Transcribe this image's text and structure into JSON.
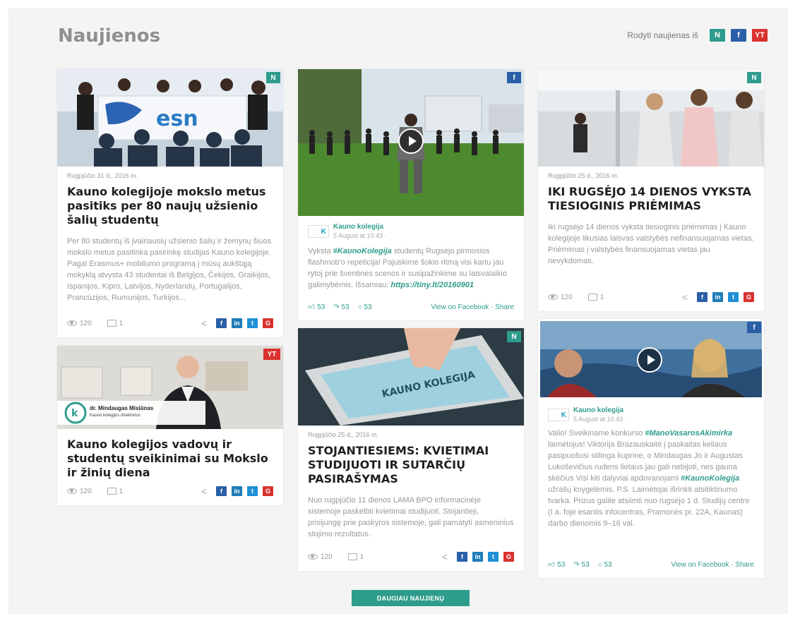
{
  "page_title": "Naujienos",
  "filter": {
    "label": "Rodyti naujienas iš",
    "buttons": [
      "N",
      "f",
      "YT"
    ]
  },
  "colors": {
    "accent": "#2e9c8d",
    "facebook": "#2a5fa7",
    "youtube": "#d9322f"
  },
  "cards": {
    "esn": {
      "source": "N",
      "date": "Rugpjūčio 31 d., 2016 m.",
      "title": "Kauno kolegijoje mokslo metus pasitiks per 80 naujų užsienio šalių studentų",
      "excerpt": "Per 80 studentų iš įvairiausių užsienio šalių ir žemynų šiuos mokslo metus pasitinka pasirinkę studijas Kauno kolegijoje. Pagal Erasmus+ mobilumo programą į mūsų aukštąją mokyklą atvysta 43 studentai iš Belgijos, Čekijos, Graikijos, Ispanijos, Kipro, Latvijos,  Nyderlandų, Portugalijos, Prancūzijos, Rumunijos,  Turkijos...",
      "image_text": "esn",
      "views": "120",
      "comments": "1"
    },
    "director": {
      "source": "YT",
      "title": "Kauno kolegijos vadovų ir studentų sveikinimai su Mokslo ir žinių diena",
      "caption_name": "dr. Mindaugas Misiūnas",
      "caption_role": "Kauno kolegijos direktorius",
      "views": "120",
      "comments": "1"
    },
    "flashmob": {
      "source": "f",
      "author": "Kauno kolegija",
      "time": "5 August at 10:43 ·",
      "text_before": "Vyksta ",
      "tag": "#KaunoKolegija",
      "text_after": " studentų Rugsėjo pirmosios flashmob'o repeticija! Pajuskime šokio ritmą visi kartu jau rytoj prie šventinės scenos ir susipažinkime su laisvalaikio galimybėmis. Išsamiau: ",
      "link": "https://tiny.lt/20160901",
      "likes": "53",
      "shares": "53",
      "comments": "53",
      "view_label": "View on Facebook · Share"
    },
    "tablet": {
      "source": "N",
      "date": "Rugpjūčio 25 d., 2016 m.",
      "title": "STOJANTIESIEMS: KVIETIMAI STUDIJUOTI IR SUTARČIŲ PASIRAŠYMAS",
      "excerpt": "Nuo rugpjūčio 11 dienos  LAMA BPO informacinėje sistemoje paskelbti kvietimai studijuoti. Stojantieji, prisijungę prie paskyros sistemoje, gali pamatyti asmeninius stojimo rezultatus.",
      "screen_text": "KAUNO KOLEGIJA",
      "views": "120",
      "comments": "1"
    },
    "admission": {
      "source": "N",
      "date": "Rugpjūčio 25 d., 2016 m.",
      "title": "IKI RUGSĖJO 14 DIENOS VYKSTA TIESIOGINIS PRIĖMIMAS",
      "excerpt": "Iki rugsėjo 14 dienos vyksta tiesioginis priėmimas į Kauno kolegijoje likusias laisvas valstybės nefinansuojamas vietas. Priėmimas į valstybės finansuojamas vietas jau nevykdomas.",
      "views": "120",
      "comments": "1"
    },
    "contest": {
      "source": "f",
      "author": "Kauno kolegija",
      "time": "5 August at 10:43 ·",
      "text_1": "Valio! Sveikiname konkurso ",
      "tag_1": "#ManoVasarosAkimirka",
      "text_2": " laimėtojus! Viktorija Brazauskaitė į paskaitas keliaus pasipuošusi stilinga kuprine, o Mindaugas Jo ir Augustas Lukoševičius rudens lietaus jau gali nebijoti, nes gauna skėčius Visi kiti dalyviai apdovanojami ",
      "tag_2": "#KaunoKolegija",
      "text_3": " užrašų knygelėmis. P.S. Laimėtojai išrinkti atsitiktinumo tvarka. Prizus galite atsiimti nuo rugsėjo 1 d. Studijų centre (I a. fojė esantis infocentras, Pramonės pr. 22A, Kaunas) darbo dienomis 9–16 val.",
      "likes": "53",
      "shares": "53",
      "comments": "53",
      "view_label": "View on Facebook · Share"
    }
  },
  "share": {
    "f": "f",
    "in": "in",
    "tw": "t",
    "g": "G"
  },
  "load_more": "DAUGIAU NAUJIENŲ"
}
